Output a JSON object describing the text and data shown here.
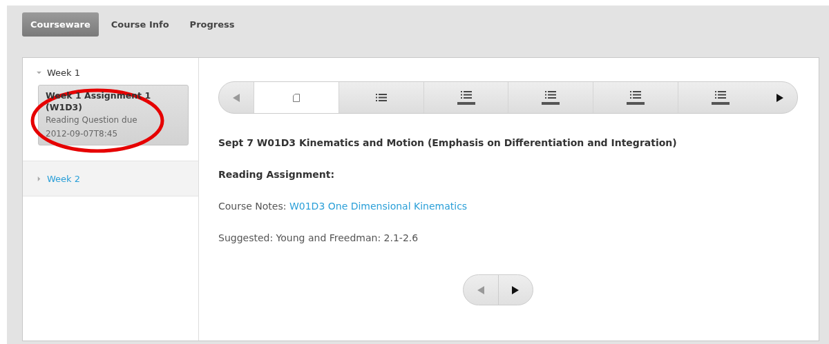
{
  "tabs": [
    {
      "label": "Courseware",
      "selected": true
    },
    {
      "label": "Course Info",
      "selected": false
    },
    {
      "label": "Progress",
      "selected": false
    }
  ],
  "sidebar": {
    "chapters": [
      {
        "title": "Week 1",
        "expanded": true,
        "children": [
          {
            "title": "Week 1 Assignment 1 (W1D3)",
            "subtitle": "Reading Question due",
            "due": "2012-09-07T8:45",
            "selected": true
          }
        ]
      },
      {
        "title": "Week 2",
        "expanded": false
      }
    ]
  },
  "sequence": {
    "prev_disabled": true,
    "next_disabled": false,
    "items": [
      {
        "kind": "page",
        "selected": true,
        "completed": false
      },
      {
        "kind": "list",
        "selected": false,
        "completed": false
      },
      {
        "kind": "list",
        "selected": false,
        "completed": true
      },
      {
        "kind": "list",
        "selected": false,
        "completed": true
      },
      {
        "kind": "list",
        "selected": false,
        "completed": true
      },
      {
        "kind": "list",
        "selected": false,
        "completed": true
      }
    ]
  },
  "content": {
    "heading": "Sept 7 W01D3 Kinematics and Motion (Emphasis on Differentiation and Integration)",
    "subheading": "Reading Assignment:",
    "notes_label": "Course Notes: ",
    "notes_link": "W01D3 One Dimensional Kinematics",
    "suggested": "Suggested: Young and Freedman: 2.1-2.6"
  },
  "bottom_nav": {
    "prev_disabled": true,
    "next_disabled": false
  }
}
